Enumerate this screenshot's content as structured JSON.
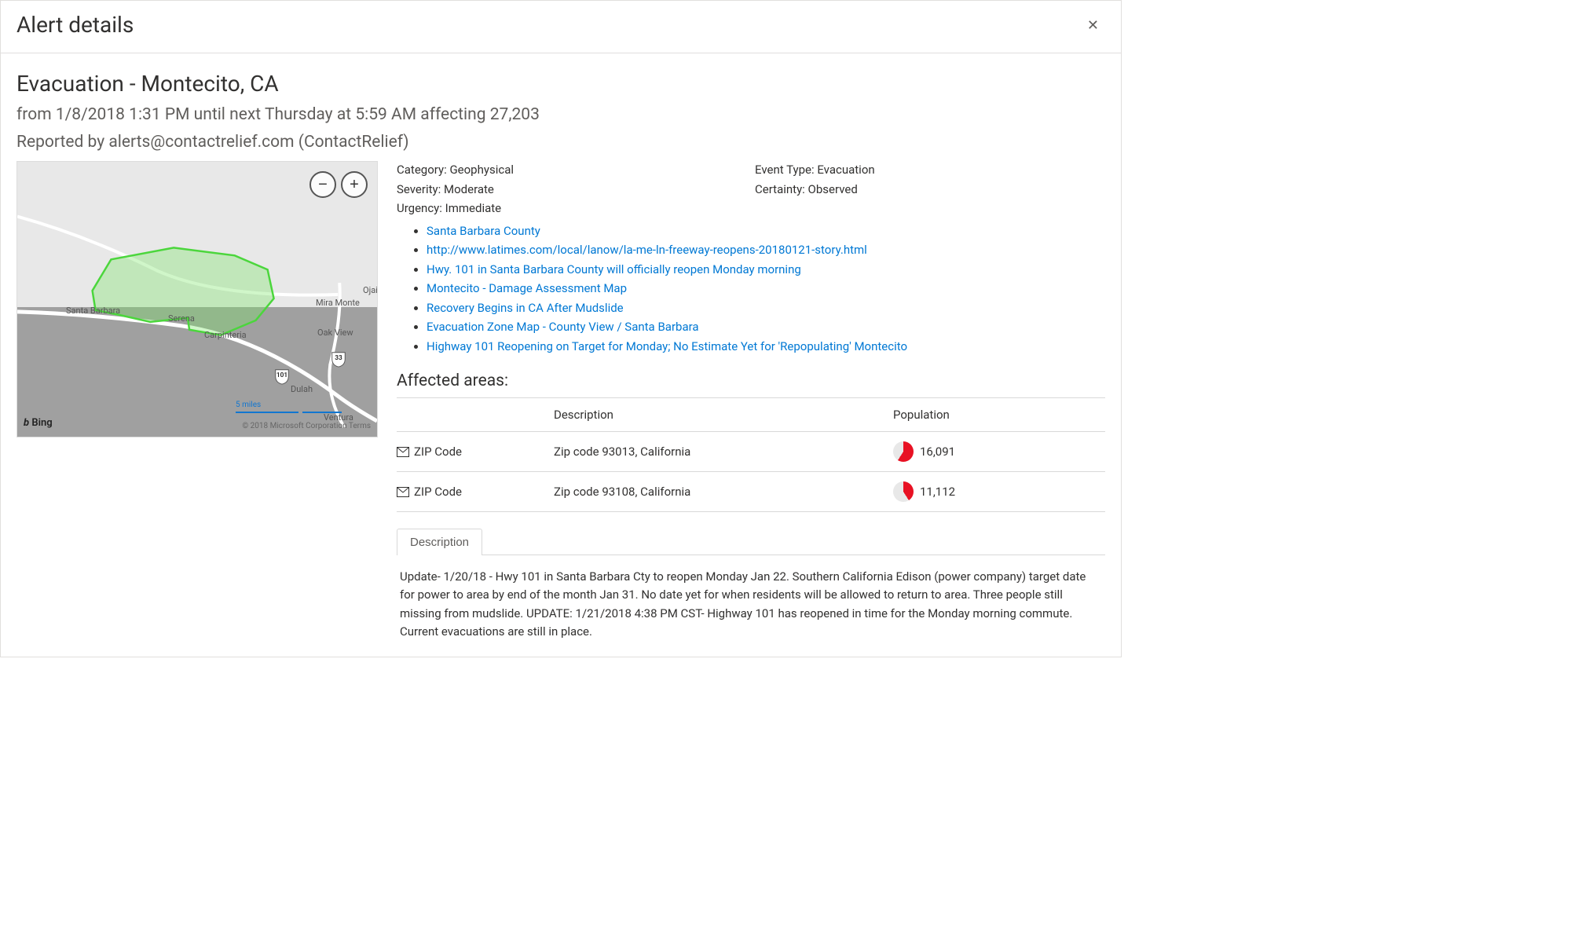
{
  "dialog": {
    "title": "Alert details",
    "close": "✕"
  },
  "alert": {
    "title": "Evacuation - Montecito, CA",
    "time": "from 1/8/2018 1:31 PM until next Thursday at 5:59 AM affecting 27,203",
    "reporter": "Reported by alerts@contactrelief.com (ContactRelief)"
  },
  "meta": {
    "category_label": "Category:",
    "category": "Geophysical",
    "eventtype_label": "Event Type:",
    "eventtype": "Evacuation",
    "severity_label": "Severity:",
    "severity": "Moderate",
    "certainty_label": "Certainty:",
    "certainty": "Observed",
    "urgency_label": "Urgency:",
    "urgency": "Immediate"
  },
  "links": [
    "Santa Barbara County",
    "http://www.latimes.com/local/lanow/la-me-ln-freeway-reopens-20180121-story.html",
    "Hwy. 101 in Santa Barbara County will officially reopen Monday morning",
    "Montecito - Damage Assessment Map",
    "Recovery Begins in CA After Mudslide",
    "Evacuation Zone Map - County View / Santa Barbara",
    "Highway 101 Reopening on Target for Monday; No Estimate Yet for 'Repopulating' Montecito"
  ],
  "areas": {
    "title": "Affected areas:",
    "headers": {
      "type": "",
      "description": "Description",
      "population": "Population"
    },
    "rows": [
      {
        "type": "ZIP Code",
        "description": "Zip code 93013, California",
        "population": "16,091",
        "pie_pct": 59
      },
      {
        "type": "ZIP Code",
        "description": "Zip code 93108, California",
        "population": "11,112",
        "pie_pct": 41
      }
    ]
  },
  "tabs": {
    "description_label": "Description"
  },
  "description_body": "Update- 1/20/18 - Hwy 101 in Santa Barbara Cty to reopen Monday Jan 22. Southern California Edison (power company) target date for power to area by end of the month Jan 31. No date yet for when residents will be allowed to return to area. Three people still missing from mudslide. UPDATE: 1/21/2018 4:38 PM CST- Highway 101 has reopened in time for the Monday morning commute. Current evacuations are still in place.",
  "map": {
    "logo": "Bing",
    "zoom_out": "−",
    "zoom_in": "+",
    "scale_label": "5 miles",
    "credit": "© 2018 Microsoft Corporation  Terms",
    "labels": {
      "ojai": "Ojai",
      "mira_monte": "Mira Monte",
      "oak_view": "Oak View",
      "santa_barbara": "Santa Barbara",
      "serena": "Serena",
      "carpinteria": "Carpinteria",
      "dulah": "Dulah",
      "ventura": "Ventura",
      "hwy33": "33",
      "hwy101": "101"
    }
  }
}
